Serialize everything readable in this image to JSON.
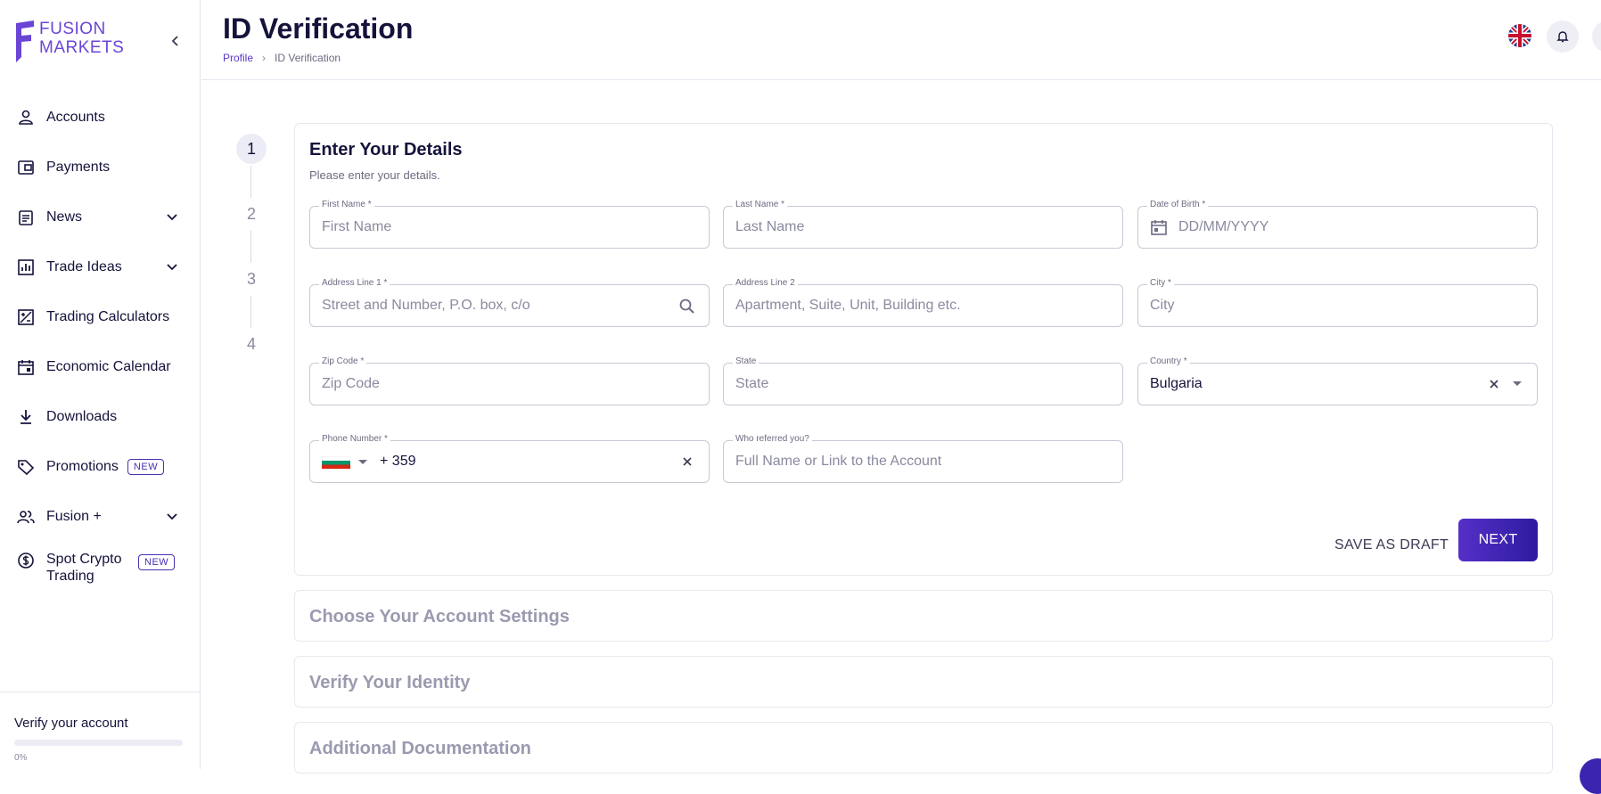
{
  "brand": {
    "line1": "FUSION",
    "line2": "MARKETS"
  },
  "sidebar": {
    "items": [
      {
        "label": "Accounts"
      },
      {
        "label": "Payments"
      },
      {
        "label": "News"
      },
      {
        "label": "Trade Ideas"
      },
      {
        "label": "Trading Calculators"
      },
      {
        "label": "Economic Calendar"
      },
      {
        "label": "Downloads"
      },
      {
        "label": "Promotions",
        "badge": "NEW"
      },
      {
        "label": "Fusion +"
      },
      {
        "label": "Spot Crypto Trading",
        "badge": "NEW"
      }
    ],
    "verify": {
      "title": "Verify your account",
      "progress": 0,
      "progress_label": "0%"
    }
  },
  "header": {
    "title": "ID Verification",
    "breadcrumb": {
      "parent": "Profile",
      "sep": "›",
      "current": "ID Verification"
    }
  },
  "stepper": {
    "steps": [
      "1",
      "2",
      "3",
      "4"
    ],
    "active": 1
  },
  "form": {
    "title": "Enter Your Details",
    "subtitle": "Please enter your details.",
    "fields": {
      "first_name": {
        "label": "First Name *",
        "placeholder": "First Name",
        "value": ""
      },
      "last_name": {
        "label": "Last Name *",
        "placeholder": "Last Name",
        "value": ""
      },
      "dob": {
        "label": "Date of Birth *",
        "placeholder": "DD/MM/YYYY",
        "value": ""
      },
      "address1": {
        "label": "Address Line 1 *",
        "placeholder": "Street and Number, P.O. box, c/o",
        "value": ""
      },
      "address2": {
        "label": "Address Line 2",
        "placeholder": "Apartment, Suite, Unit, Building etc.",
        "value": ""
      },
      "city": {
        "label": "City *",
        "placeholder": "City",
        "value": ""
      },
      "zip": {
        "label": "Zip Code *",
        "placeholder": "Zip Code",
        "value": ""
      },
      "state": {
        "label": "State",
        "placeholder": "State",
        "value": ""
      },
      "country": {
        "label": "Country *",
        "value": "Bulgaria"
      },
      "phone": {
        "label": "Phone Number *",
        "value": "+ 359"
      },
      "referrer": {
        "label": "Who referred you?",
        "placeholder": "Full Name or Link to the Account",
        "value": ""
      }
    },
    "save_draft": "SAVE AS DRAFT",
    "next": "NEXT"
  },
  "sections": [
    {
      "title": "Choose Your Account Settings"
    },
    {
      "title": "Verify Your Identity"
    },
    {
      "title": "Additional Documentation"
    }
  ],
  "colors": {
    "brand": "#5530c8",
    "text": "#14133b",
    "muted": "#9a9ab0"
  }
}
